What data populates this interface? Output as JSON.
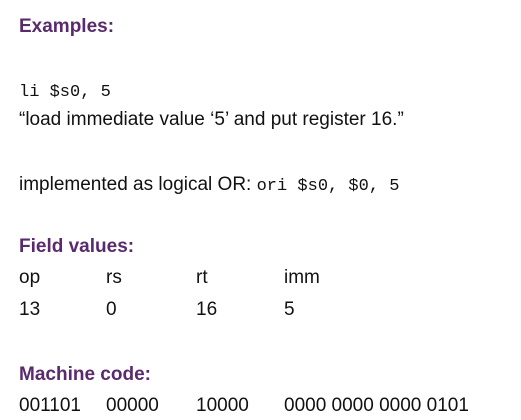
{
  "colors": {
    "heading": "#5a2a6e",
    "text": "#111111",
    "background": "#ffffff"
  },
  "examples": {
    "heading": "Examples:",
    "instruction": "li $s0, 5",
    "description": "“load immediate value ‘5’ and put register 16.”",
    "implemented_prefix": "implemented as logical OR: ",
    "implemented_code": "ori $s0, $0, 5"
  },
  "field_values": {
    "heading": "Field values:",
    "headers": [
      "op",
      "rs",
      "rt",
      "imm"
    ],
    "values": [
      "13",
      "0",
      "16",
      "5"
    ]
  },
  "machine_code": {
    "heading": "Machine code:",
    "fields": [
      "001101",
      "00000",
      "10000",
      "0000 0000 0000 0101"
    ]
  }
}
